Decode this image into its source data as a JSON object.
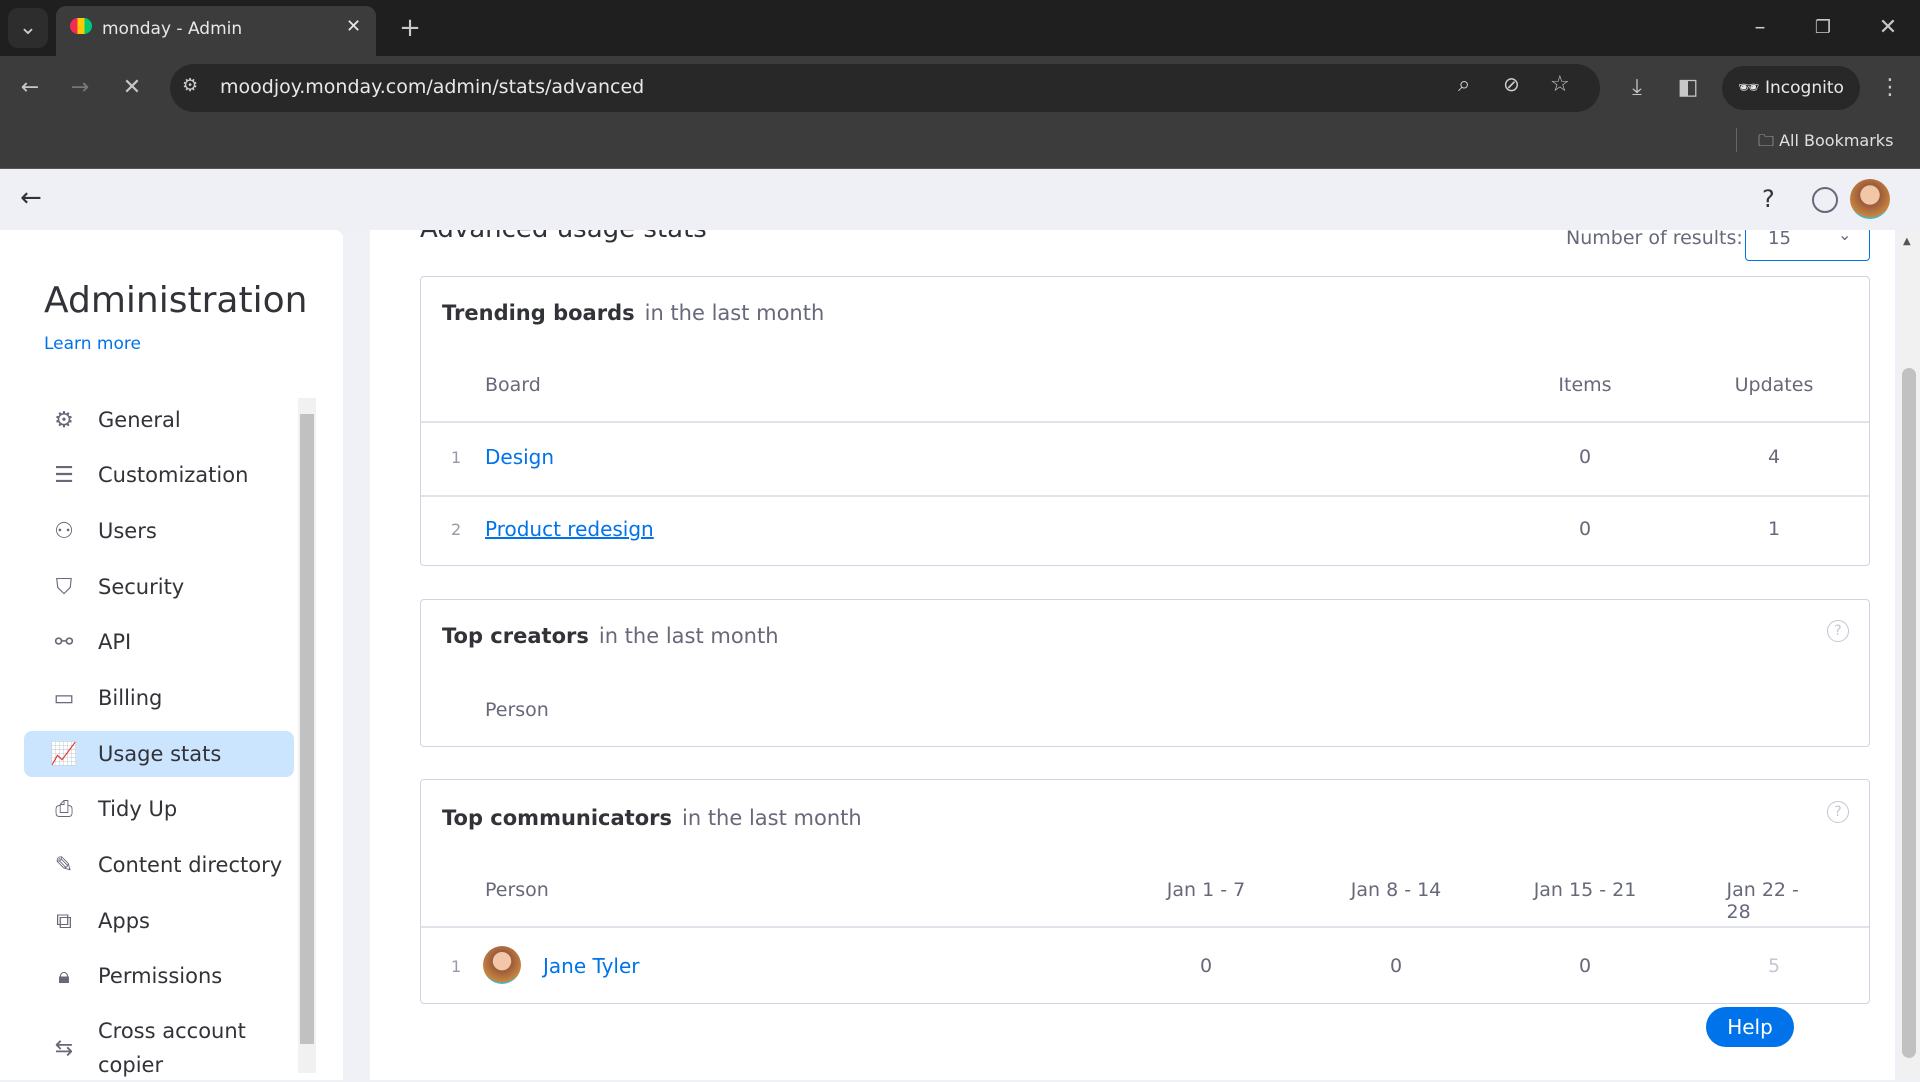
{
  "browser": {
    "tab_title": "monday - Admin",
    "url": "moodjoy.monday.com/admin/stats/advanced",
    "profile": "Incognito",
    "bookmarks": "All Bookmarks"
  },
  "sidebar": {
    "title": "Administration",
    "learn_more": "Learn more",
    "items": [
      {
        "label": "General",
        "icon": "gear-icon"
      },
      {
        "label": "Customization",
        "icon": "sliders-icon"
      },
      {
        "label": "Users",
        "icon": "users-icon"
      },
      {
        "label": "Security",
        "icon": "shield-icon"
      },
      {
        "label": "API",
        "icon": "api-icon"
      },
      {
        "label": "Billing",
        "icon": "credit-card-icon"
      },
      {
        "label": "Usage stats",
        "icon": "chart-icon",
        "active": true
      },
      {
        "label": "Tidy Up",
        "icon": "shredder-icon"
      },
      {
        "label": "Content directory",
        "icon": "content-directory-icon"
      },
      {
        "label": "Apps",
        "icon": "puzzle-icon"
      },
      {
        "label": "Permissions",
        "icon": "lock-icon"
      },
      {
        "label": "Cross account copier",
        "icon": "swap-icon"
      }
    ]
  },
  "main": {
    "title": "Advanced usage stats",
    "results_label": "Number of results:",
    "results_value": "15",
    "trending": {
      "title": "Trending boards",
      "subtitle": "in the last month",
      "headers": [
        "Board",
        "Items",
        "Updates"
      ],
      "rows": [
        {
          "n": "1",
          "board": "Design",
          "items": "0",
          "updates": "4"
        },
        {
          "n": "2",
          "board": "Product redesign",
          "items": "0",
          "updates": "1"
        }
      ]
    },
    "creators": {
      "title": "Top creators",
      "subtitle": "in the last month",
      "headers": [
        "Person"
      ]
    },
    "communicators": {
      "title": "Top communicators",
      "subtitle": "in the last month",
      "headers": [
        "Person",
        "Jan 1 - 7",
        "Jan 8 - 14",
        "Jan 15 - 21",
        "Jan 22 - 28"
      ],
      "rows": [
        {
          "n": "1",
          "person": "Jane Tyler",
          "values": [
            "0",
            "0",
            "0",
            "5"
          ]
        }
      ]
    }
  },
  "help_button": "Help",
  "colors": {
    "accent": "#0073ea",
    "active_bg": "#cce5ff"
  }
}
